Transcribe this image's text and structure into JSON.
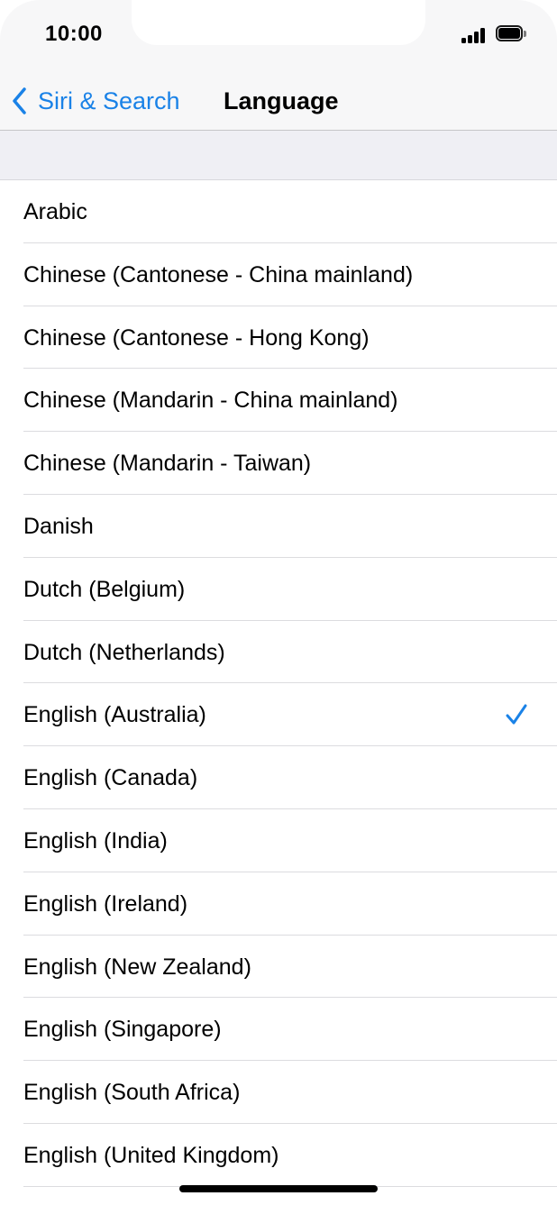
{
  "status_bar": {
    "time": "10:00"
  },
  "nav": {
    "back_label": "Siri & Search",
    "title": "Language"
  },
  "languages": [
    {
      "label": "Arabic",
      "selected": false
    },
    {
      "label": "Chinese (Cantonese - China mainland)",
      "selected": false
    },
    {
      "label": "Chinese (Cantonese - Hong Kong)",
      "selected": false
    },
    {
      "label": "Chinese (Mandarin - China mainland)",
      "selected": false
    },
    {
      "label": "Chinese (Mandarin - Taiwan)",
      "selected": false
    },
    {
      "label": "Danish",
      "selected": false
    },
    {
      "label": "Dutch (Belgium)",
      "selected": false
    },
    {
      "label": "Dutch (Netherlands)",
      "selected": false
    },
    {
      "label": "English (Australia)",
      "selected": true
    },
    {
      "label": "English (Canada)",
      "selected": false
    },
    {
      "label": "English (India)",
      "selected": false
    },
    {
      "label": "English (Ireland)",
      "selected": false
    },
    {
      "label": "English (New Zealand)",
      "selected": false
    },
    {
      "label": "English (Singapore)",
      "selected": false
    },
    {
      "label": "English (South Africa)",
      "selected": false
    },
    {
      "label": "English (United Kingdom)",
      "selected": false
    }
  ],
  "colors": {
    "accent": "#1a82e7",
    "background": "#efeff4"
  },
  "icons": {
    "back": "chevron-left-icon",
    "selected": "checkmark-icon"
  }
}
